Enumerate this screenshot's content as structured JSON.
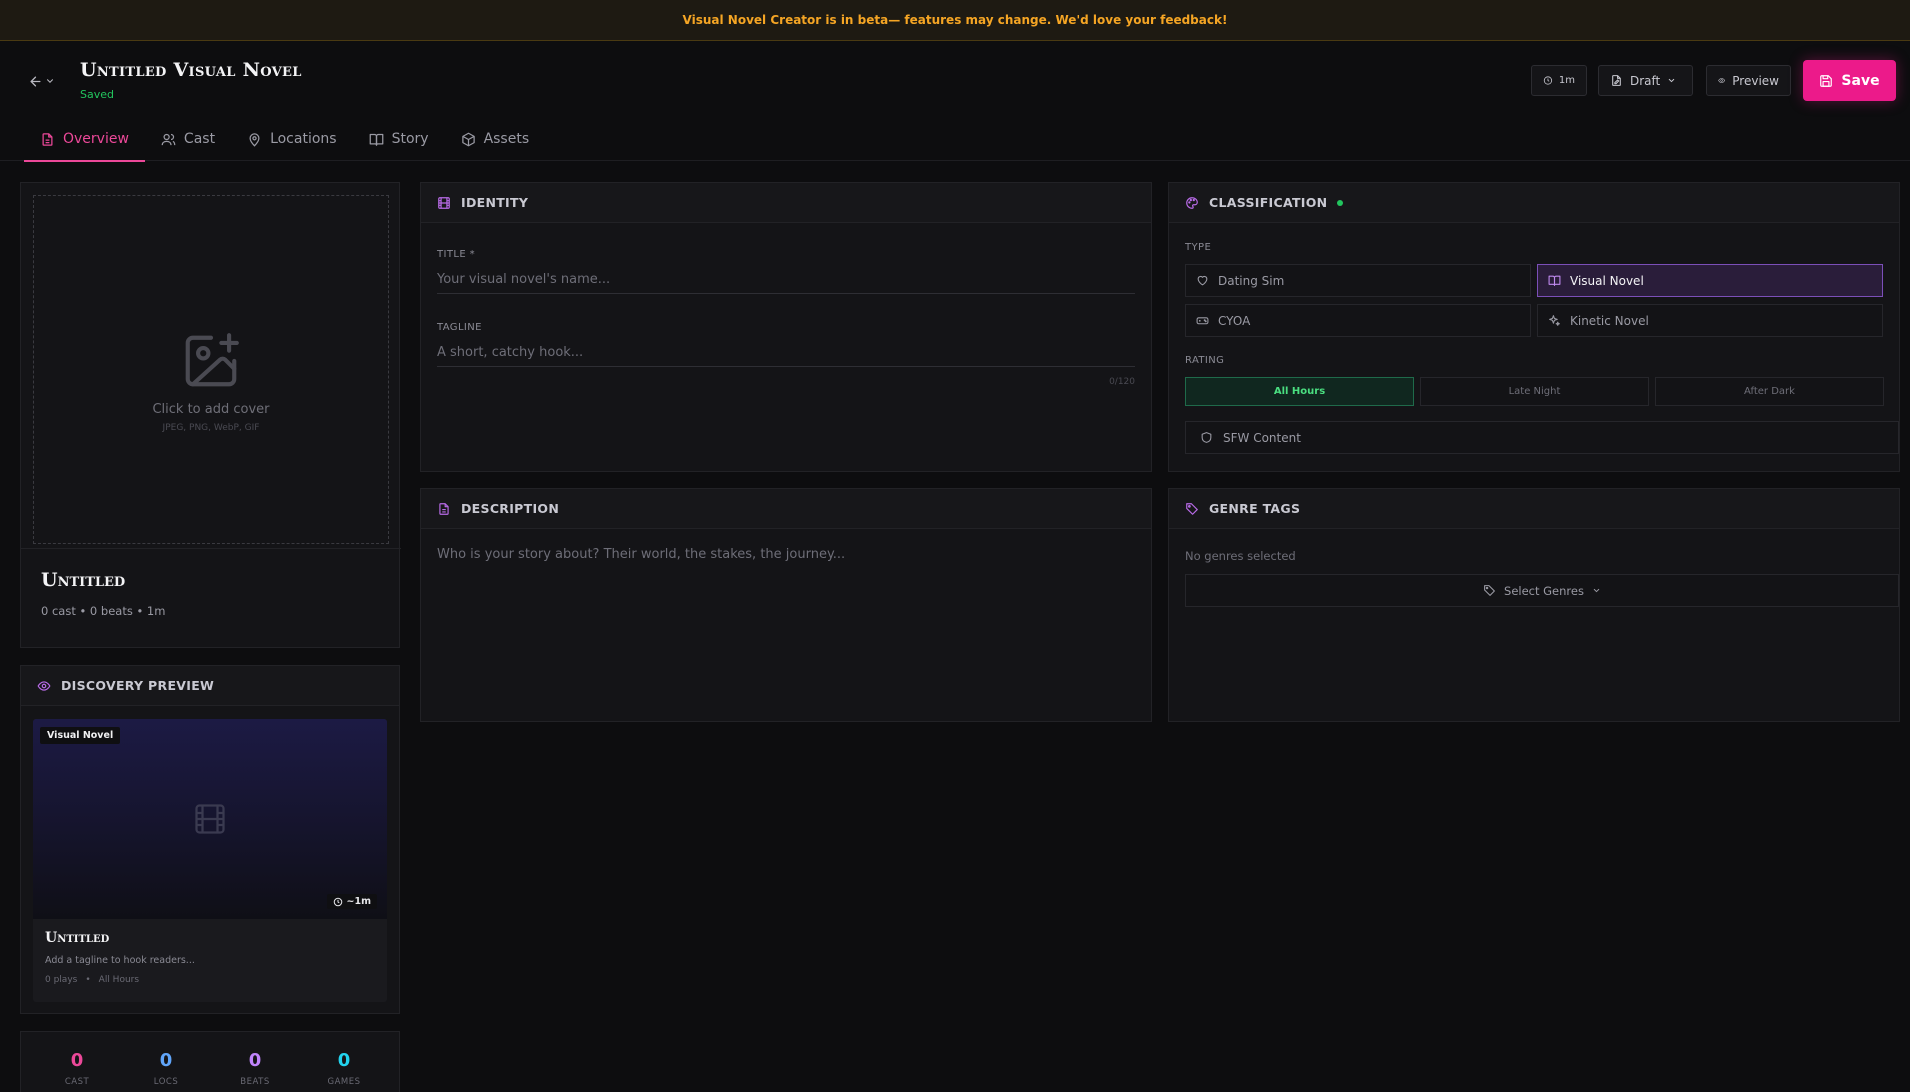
{
  "banner": {
    "text": "Visual Novel Creator is in beta— features may change. We'd love your feedback!"
  },
  "header": {
    "title": "Untitled Visual Novel",
    "status": "Saved",
    "time": "1m",
    "draft_label": "Draft",
    "preview_label": "Preview",
    "save_label": "Save"
  },
  "tabs": [
    {
      "label": "Overview",
      "icon": "document-icon"
    },
    {
      "label": "Cast",
      "icon": "users-icon"
    },
    {
      "label": "Locations",
      "icon": "map-pin-icon"
    },
    {
      "label": "Story",
      "icon": "book-icon"
    },
    {
      "label": "Assets",
      "icon": "box-icon"
    }
  ],
  "cover": {
    "text": "Click to add cover",
    "formats": "JPEG, PNG, WebP, GIF",
    "name": "Untitled",
    "meta": "0 cast • 0 beats • 1m"
  },
  "discovery": {
    "title": "DISCOVERY PREVIEW",
    "badge": "Visual Novel",
    "time": "~1m",
    "name": "Untitled",
    "tagline": "Add a tagline to hook readers...",
    "plays": "0 plays",
    "dot": "•",
    "rating": "All Hours"
  },
  "stats": [
    {
      "value": "0",
      "label": "CAST",
      "color": "#ec4899"
    },
    {
      "value": "0",
      "label": "LOCS",
      "color": "#60a5fa"
    },
    {
      "value": "0",
      "label": "BEATS",
      "color": "#c084fc"
    },
    {
      "value": "0",
      "label": "GAMES",
      "color": "#22d3ee"
    }
  ],
  "identity": {
    "title": "IDENTITY",
    "title_label": "TITLE *",
    "title_placeholder": "Your visual novel's name...",
    "tagline_label": "TAGLINE",
    "tagline_placeholder": "A short, catchy hook...",
    "counter": "0/120"
  },
  "description": {
    "title": "DESCRIPTION",
    "placeholder": "Who is your story about? Their world, the stakes, the journey..."
  },
  "classification": {
    "title": "CLASSIFICATION",
    "type_label": "TYPE",
    "types": [
      "Dating Sim",
      "Visual Novel",
      "CYOA",
      "Kinetic Novel"
    ],
    "selected_type": "Visual Novel",
    "rating_label": "RATING",
    "ratings": [
      "All Hours",
      "Late Night",
      "After Dark"
    ],
    "selected_rating": "All Hours",
    "content": "SFW Content"
  },
  "genres": {
    "title": "GENRE TAGS",
    "empty": "No genres selected",
    "button": "Select Genres"
  },
  "colors": {
    "accent": "#ec1a8a",
    "purple": "#b96be8",
    "green": "#22c55e",
    "warning": "#f5a524"
  }
}
